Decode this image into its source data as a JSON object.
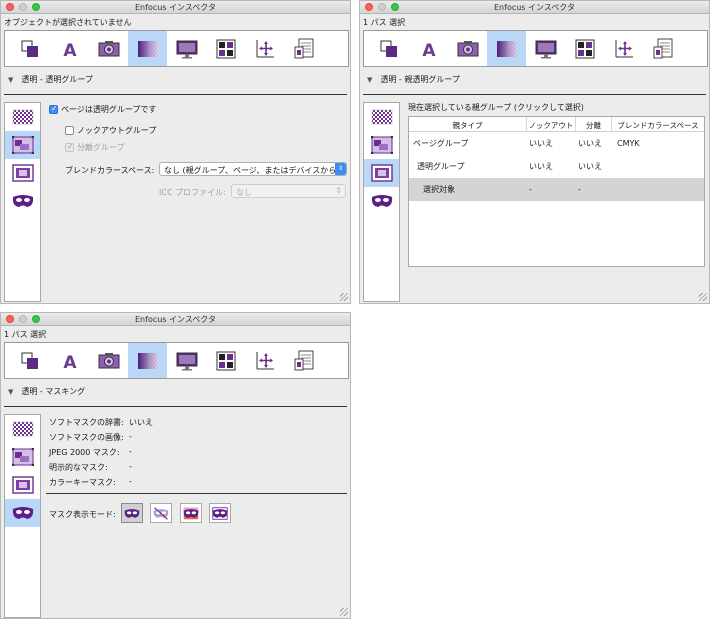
{
  "app_title": "Enfocus インスペクタ",
  "colors": {
    "accent": "#3b8cf5",
    "selection": "#b9d8f8",
    "icon_purple": "#6b2d8f"
  },
  "toolbar_icons": [
    "object-icon",
    "text-icon",
    "image-icon",
    "transparency-icon",
    "display-icon",
    "color-grid-icon",
    "position-icon",
    "document-icon"
  ],
  "side_icons": [
    "page-transparency-icon",
    "group-transparency-icon",
    "object-transparency-icon",
    "mask-icon"
  ],
  "win1": {
    "selection_info": "オブジェクトが選択されていません",
    "section_title": "透明 - 透明グループ",
    "page_group_checkbox": "ページは透明グループです",
    "knockout_checkbox": "ノックアウトグループ",
    "isolated_checkbox": "分離グループ",
    "blend_label": "ブレンドカラースペース:",
    "blend_value": "なし (親グループ、ページ、またはデバイスから継承)",
    "icc_label": "ICC プロファイル:",
    "icc_value": "なし"
  },
  "win2": {
    "selection_info": "1 パス 選択",
    "section_title": "透明 - 親透明グループ",
    "table_caption": "現在選択している親グループ (クリックして選択)",
    "columns": [
      "親タイプ",
      "ノックアウト",
      "分離",
      "ブレンドカラースペース"
    ],
    "rows": [
      [
        "ページグループ",
        "いいえ",
        "いいえ",
        "CMYK"
      ],
      [
        "透明グループ",
        "いいえ",
        "いいえ",
        ""
      ],
      [
        "選択対象",
        "-",
        "-",
        ""
      ]
    ]
  },
  "win3": {
    "selection_info": "1 パス 選択",
    "section_title": "透明 - マスキング",
    "fields": [
      {
        "label": "ソフトマスクの辞書:",
        "value": "いいえ"
      },
      {
        "label": "ソフトマスクの画像:",
        "value": "-"
      },
      {
        "label": "JPEG 2000 マスク:",
        "value": "-"
      },
      {
        "label": "明示的なマスク:",
        "value": "-"
      },
      {
        "label": "カラーキーマスク:",
        "value": "-"
      }
    ],
    "mask_mode_label": "マスク表示モード:",
    "mask_mode_icons": [
      "mask-show-icon",
      "mask-hide-icon",
      "mask-color-icon",
      "mask-outline-icon"
    ]
  }
}
